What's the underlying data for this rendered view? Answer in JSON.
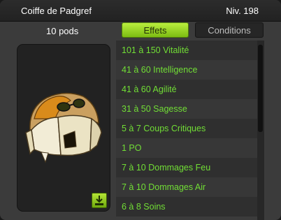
{
  "item": {
    "name": "Coiffe de Padgref",
    "level": "Niv. 198",
    "weight": "10 pods"
  },
  "tabs": [
    {
      "label": "Effets",
      "active": true
    },
    {
      "label": "Conditions",
      "active": false
    }
  ],
  "effects": [
    "101 à 150 Vitalité",
    "41 à 60 Intelligence",
    "41 à 60 Agilité",
    "31 à 50 Sagesse",
    "5 à 7 Coups Critiques",
    "1 PO",
    "7 à 10 Dommages Feu",
    "7 à 10 Dommages Air",
    "6 à 8 Soins"
  ],
  "colors": {
    "effect_text": "#71de35",
    "active_tab": "#9bd524"
  },
  "icons": {
    "equip": "equip-arrow-icon"
  }
}
